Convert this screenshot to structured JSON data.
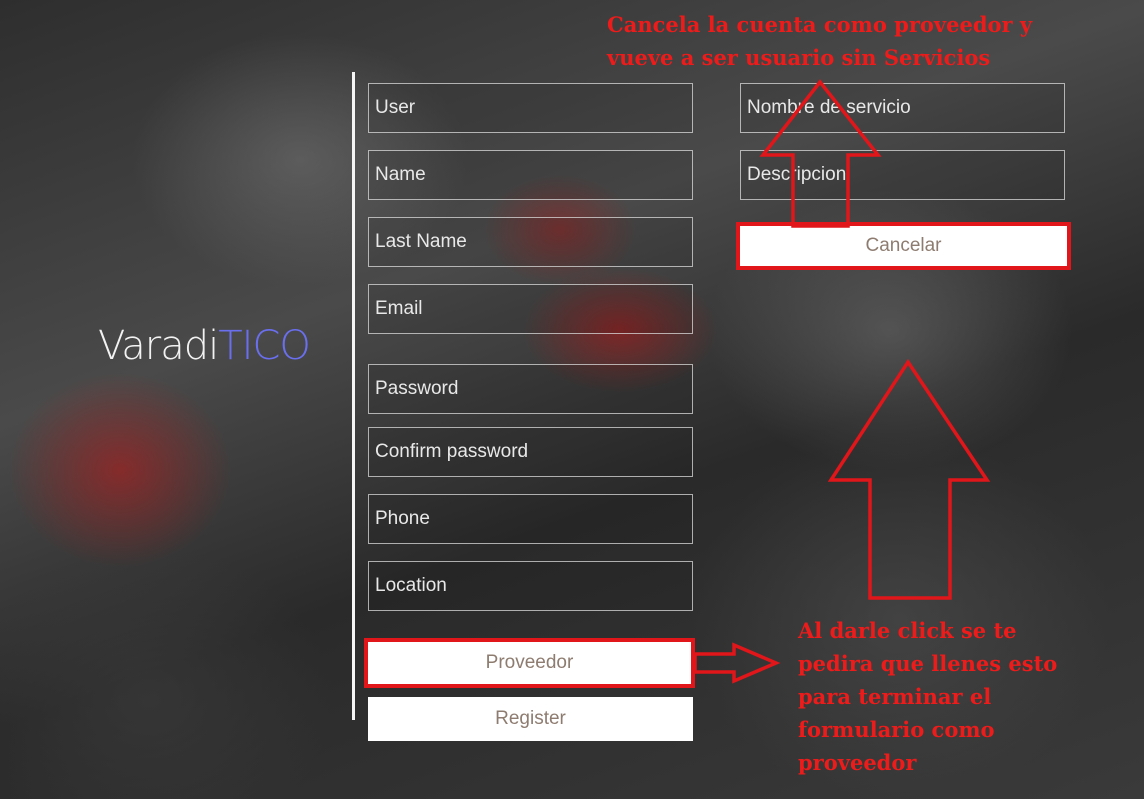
{
  "brand": {
    "name_plain": "Varadi",
    "name_accent": "TICO"
  },
  "form": {
    "user_placeholder": "User",
    "name_placeholder": "Name",
    "lastname_placeholder": "Last Name",
    "email_placeholder": "Email",
    "password_placeholder": "Password",
    "confirm_placeholder": "Confirm password",
    "phone_placeholder": "Phone",
    "location_placeholder": "Location",
    "proveedor_label": "Proveedor",
    "register_label": "Register"
  },
  "provider": {
    "service_name_placeholder": "Nombre de servicio",
    "description_placeholder": "Descripcion",
    "cancel_label": "Cancelar"
  },
  "annotations": {
    "top": [
      "Cancela la cuenta como proveedor y",
      "vueve a ser usuario sin Servicios"
    ],
    "bottom": [
      "Al darle click se te",
      "pedira que llenes esto",
      "para terminar el",
      "formulario como",
      "proveedor"
    ]
  },
  "colors": {
    "accent": "#6a6ff0",
    "annotation": "#ee1b1b",
    "button_text": "#8e7c70"
  },
  "icons": [
    "arrow-up-icon",
    "arrow-right-icon"
  ]
}
